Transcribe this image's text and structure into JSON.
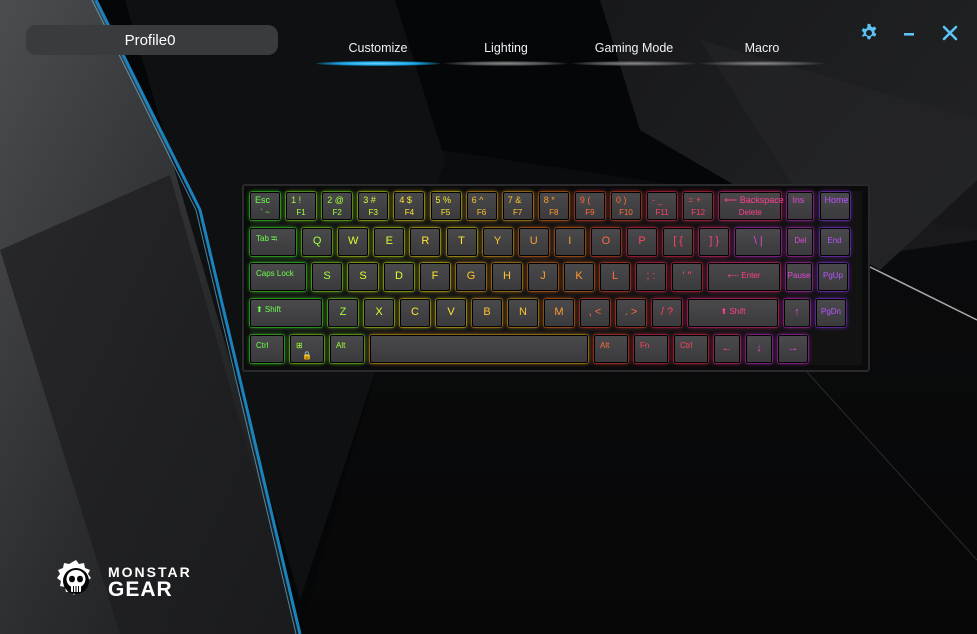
{
  "profile": {
    "name": "Profile0"
  },
  "tabs": [
    {
      "label": "Customize",
      "active": true
    },
    {
      "label": "Lighting",
      "active": false
    },
    {
      "label": "Gaming Mode",
      "active": false
    },
    {
      "label": "Macro",
      "active": false
    }
  ],
  "window": {
    "settings_icon": "gear-icon",
    "minimize_icon": "minimize-icon",
    "close_icon": "close-icon",
    "accent": "#5bc4f5"
  },
  "keyboard": {
    "rows": [
      [
        {
          "top": "Esc",
          "bot": "` ~"
        },
        {
          "top": "1 !",
          "bot": "F1"
        },
        {
          "top": "2 @",
          "bot": "F2"
        },
        {
          "top": "3 #",
          "bot": "F3"
        },
        {
          "top": "4 $",
          "bot": "F4"
        },
        {
          "top": "5 %",
          "bot": "F5"
        },
        {
          "top": "6 ^",
          "bot": "F6"
        },
        {
          "top": "7 &",
          "bot": "F7"
        },
        {
          "top": "8 *",
          "bot": "F8"
        },
        {
          "top": "9 (",
          "bot": "F9"
        },
        {
          "top": "0 )",
          "bot": "F10"
        },
        {
          "top": "- _",
          "bot": "F11"
        },
        {
          "top": "= +",
          "bot": "F12"
        },
        {
          "top": "⟵ Backspace",
          "bot": "Delete"
        },
        {
          "top": "Ins",
          "bot": ""
        },
        {
          "top": "Home",
          "bot": ""
        }
      ],
      [
        {
          "tl": "Tab ⭾"
        },
        {
          "mid": "Q"
        },
        {
          "mid": "W"
        },
        {
          "mid": "E"
        },
        {
          "mid": "R"
        },
        {
          "mid": "T"
        },
        {
          "mid": "Y"
        },
        {
          "mid": "U"
        },
        {
          "mid": "I"
        },
        {
          "mid": "O"
        },
        {
          "mid": "P"
        },
        {
          "mid": "[ {"
        },
        {
          "mid": "] }"
        },
        {
          "mid": "\\ |"
        },
        {
          "ce": "Del"
        },
        {
          "ce": "End"
        }
      ],
      [
        {
          "tl": "Caps Lock"
        },
        {
          "mid": "S"
        },
        {
          "mid": "S"
        },
        {
          "mid": "D"
        },
        {
          "mid": "F"
        },
        {
          "mid": "G"
        },
        {
          "mid": "H"
        },
        {
          "mid": "J"
        },
        {
          "mid": "K"
        },
        {
          "mid": "L"
        },
        {
          "mid": "; :"
        },
        {
          "mid": "' \""
        },
        {
          "ce": "⟵ Enter"
        },
        {
          "ce": "Pause"
        },
        {
          "ce": "PgUp"
        }
      ],
      [
        {
          "tl": "⬆ Shift"
        },
        {
          "mid": "Z"
        },
        {
          "mid": "X"
        },
        {
          "mid": "C"
        },
        {
          "mid": "V"
        },
        {
          "mid": "B"
        },
        {
          "mid": "N"
        },
        {
          "mid": "M"
        },
        {
          "mid": ", <"
        },
        {
          "mid": ". >"
        },
        {
          "mid": "/ ?"
        },
        {
          "ce": "⬆ Shift"
        },
        {
          "mid": "↑"
        },
        {
          "ce": "PgDn"
        }
      ],
      [
        {
          "tl": "Ctrl"
        },
        {
          "tl": "⊞",
          "bot": "🔒"
        },
        {
          "tl": "Alt"
        },
        {
          "mid": ""
        },
        {
          "tl": "Alt"
        },
        {
          "tl": "Fn"
        },
        {
          "tl": "Ctrl"
        },
        {
          "mid": "←"
        },
        {
          "mid": "↓"
        },
        {
          "mid": "→"
        }
      ]
    ]
  },
  "brand": {
    "line1": "MONSTAR",
    "line2": "GEAR",
    "logo_icon": "skull-gear-icon"
  }
}
